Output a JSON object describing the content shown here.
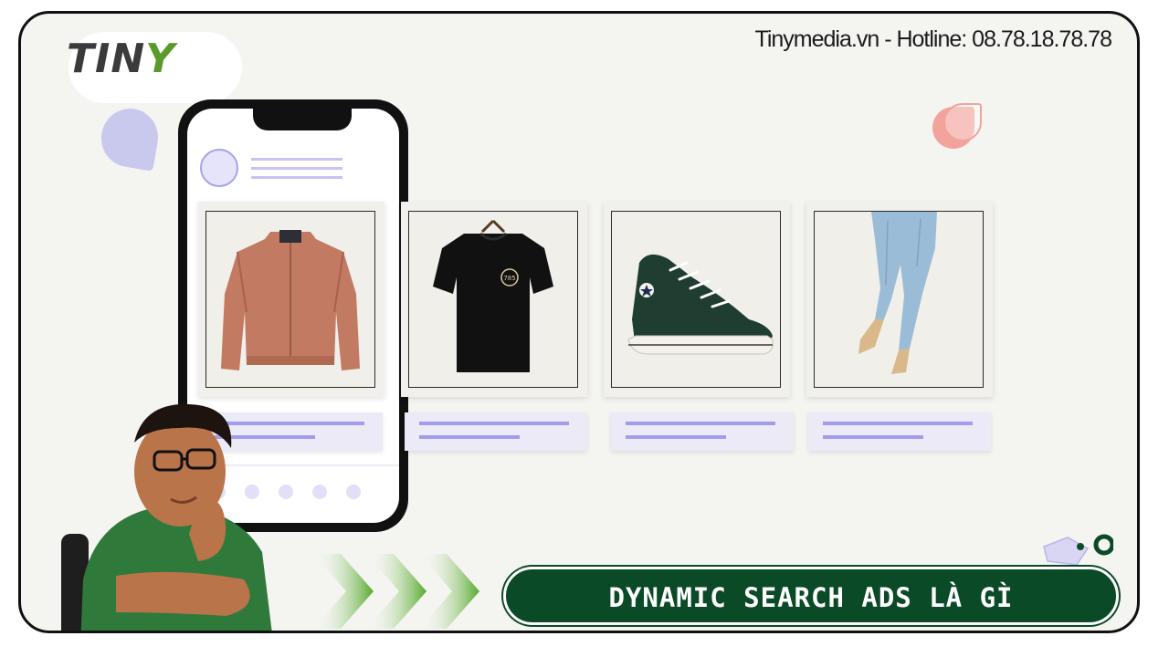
{
  "brand": {
    "logo_main": "TIN",
    "logo_accent": "Y",
    "hotline": "Tinymedia.vn - Hotline: 08.78.18.78.78"
  },
  "banner": {
    "title": "DYNAMIC SEARCH ADS LÀ GÌ"
  },
  "products": [
    {
      "name": "jacket-image"
    },
    {
      "name": "tshirt-image",
      "print": "785"
    },
    {
      "name": "sneaker-image"
    },
    {
      "name": "jeans-image"
    }
  ],
  "colors": {
    "brand_green": "#0b4a26",
    "accent_green": "#5a9a2b",
    "lavender": "#a39cec",
    "background": "#f4f4f1"
  }
}
